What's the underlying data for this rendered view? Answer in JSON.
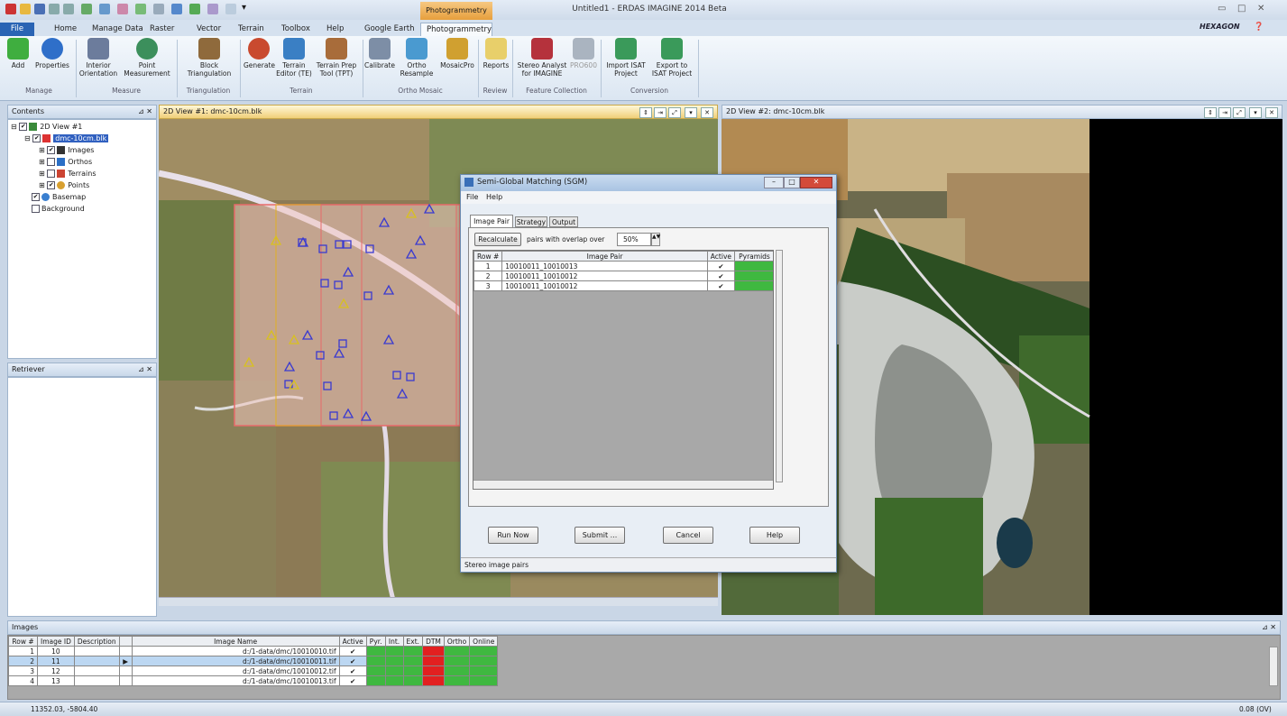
{
  "title_bar": {
    "context_tab": "Photogrammetry",
    "title": "Untitled1 - ERDAS IMAGINE 2014 Beta",
    "brand": "HEXAGON"
  },
  "ribbon": {
    "tabs": [
      "File",
      "Home",
      "Manage Data",
      "Raster",
      "Vector",
      "Terrain",
      "Toolbox",
      "Help",
      "Google Earth",
      "Photogrammetry"
    ],
    "active_tab": "Photogrammetry",
    "buttons": [
      "Add",
      "Properties",
      "Interior Orientation",
      "Point Measurement",
      "Block Triangulation",
      "Generate",
      "Terrain Editor (TE)",
      "Terrain Prep Tool (TPT)",
      "Calibrate",
      "Ortho Resample",
      "MosaicPro",
      "Reports",
      "Stereo Analyst for IMAGINE",
      "PRO600",
      "Import ISAT Project",
      "Export to ISAT Project"
    ],
    "groups": [
      "Manage",
      "Measure",
      "Triangulation",
      "Terrain",
      "Ortho Mosaic",
      "Review",
      "Feature Collection",
      "Conversion"
    ]
  },
  "contents": {
    "title": "Contents",
    "items": [
      "2D View #1",
      "dmc-10cm.blk",
      "Images",
      "Orthos",
      "Terrains",
      "Points",
      "Basemap",
      "Background"
    ]
  },
  "retriever": {
    "title": "Retriever"
  },
  "view1": {
    "title": "2D View #1: dmc-10cm.blk"
  },
  "view2": {
    "title": "2D View #2: dmc-10cm.blk"
  },
  "dialog": {
    "title": "Semi-Global Matching (SGM)",
    "menu": [
      "File",
      "Help"
    ],
    "tabs": [
      "Image Pair",
      "Strategy",
      "Output"
    ],
    "recalc_label": "Recalculate",
    "overlap_label": "pairs with overlap over",
    "overlap_value": "50%",
    "columns": [
      "Row #",
      "Image Pair",
      "Active",
      "Pyramids"
    ],
    "rows": [
      {
        "row": "1",
        "pair": "10010011_10010013",
        "active": "✔"
      },
      {
        "row": "2",
        "pair": "10010011_10010012",
        "active": "✔"
      },
      {
        "row": "3",
        "pair": "10010011_10010012",
        "active": "✔"
      }
    ],
    "buttons": [
      "Run Now",
      "Submit ...",
      "Cancel",
      "Help"
    ],
    "status": "Stereo image pairs"
  },
  "images_panel": {
    "title": "Images",
    "columns": [
      "Row #",
      "Image ID",
      "Description",
      "",
      "Image Name",
      "Active",
      "Pyr.",
      "Int.",
      "Ext.",
      "DTM",
      "Ortho",
      "Online"
    ],
    "rows": [
      {
        "row": "1",
        "id": "10",
        "desc": "",
        "mark": "",
        "name": "d:/1-data/dmc/10010010.tif",
        "active": "✔",
        "cells": [
          "g",
          "g",
          "g",
          "r",
          "g",
          "g"
        ]
      },
      {
        "row": "2",
        "id": "11",
        "desc": "",
        "mark": "▶",
        "name": "d:/1-data/dmc/10010011.tif",
        "active": "✔",
        "cells": [
          "g",
          "g",
          "g",
          "r",
          "g",
          "g"
        ]
      },
      {
        "row": "3",
        "id": "12",
        "desc": "",
        "mark": "",
        "name": "d:/1-data/dmc/10010012.tif",
        "active": "✔",
        "cells": [
          "g",
          "g",
          "g",
          "r",
          "g",
          "g"
        ]
      },
      {
        "row": "4",
        "id": "13",
        "desc": "",
        "mark": "",
        "name": "d:/1-data/dmc/10010013.tif",
        "active": "✔",
        "cells": [
          "g",
          "g",
          "g",
          "r",
          "g",
          "g"
        ]
      }
    ]
  },
  "status_bar": {
    "coords": "11352.03, -5804.40",
    "scale": "0.08 (OV)"
  },
  "colors": {
    "green": "#3fb840",
    "red": "#e22020"
  }
}
